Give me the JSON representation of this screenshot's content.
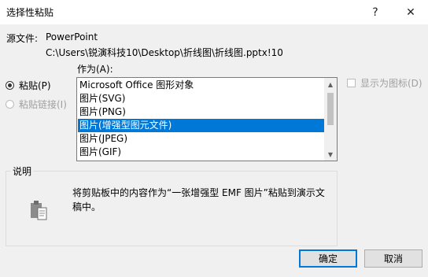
{
  "window": {
    "title": "选择性粘贴",
    "help_glyph": "?",
    "close_glyph": "✕"
  },
  "source": {
    "label": "源文件:",
    "name": "PowerPoint",
    "path": "C:\\Users\\锐演科技10\\Desktop\\折线图\\折线图.pptx!10"
  },
  "as_label": "作为(A):",
  "options": {
    "paste": {
      "label": "粘贴(P)",
      "checked": true
    },
    "paste_link": {
      "label": "粘贴链接(I)",
      "checked": false,
      "disabled": true
    }
  },
  "formats": [
    {
      "label": "Microsoft Office 图形对象",
      "selected": false
    },
    {
      "label": "图片(SVG)",
      "selected": false
    },
    {
      "label": "图片(PNG)",
      "selected": false
    },
    {
      "label": "图片(增强型图元文件)",
      "selected": true
    },
    {
      "label": "图片(JPEG)",
      "selected": false
    },
    {
      "label": "图片(GIF)",
      "selected": false
    }
  ],
  "display_as_icon": {
    "label": "显示为图标(D)",
    "checked": false,
    "disabled": true
  },
  "description": {
    "group_label": "说明",
    "text": "将剪贴板中的内容作为“一张增强型 EMF 图片”粘贴到演示文稿中。",
    "icon": "clipboard-paste-icon"
  },
  "buttons": {
    "ok": "确定",
    "cancel": "取消"
  },
  "colors": {
    "selection": "#0078d7",
    "dialog_bg": "#f0f0f0"
  }
}
